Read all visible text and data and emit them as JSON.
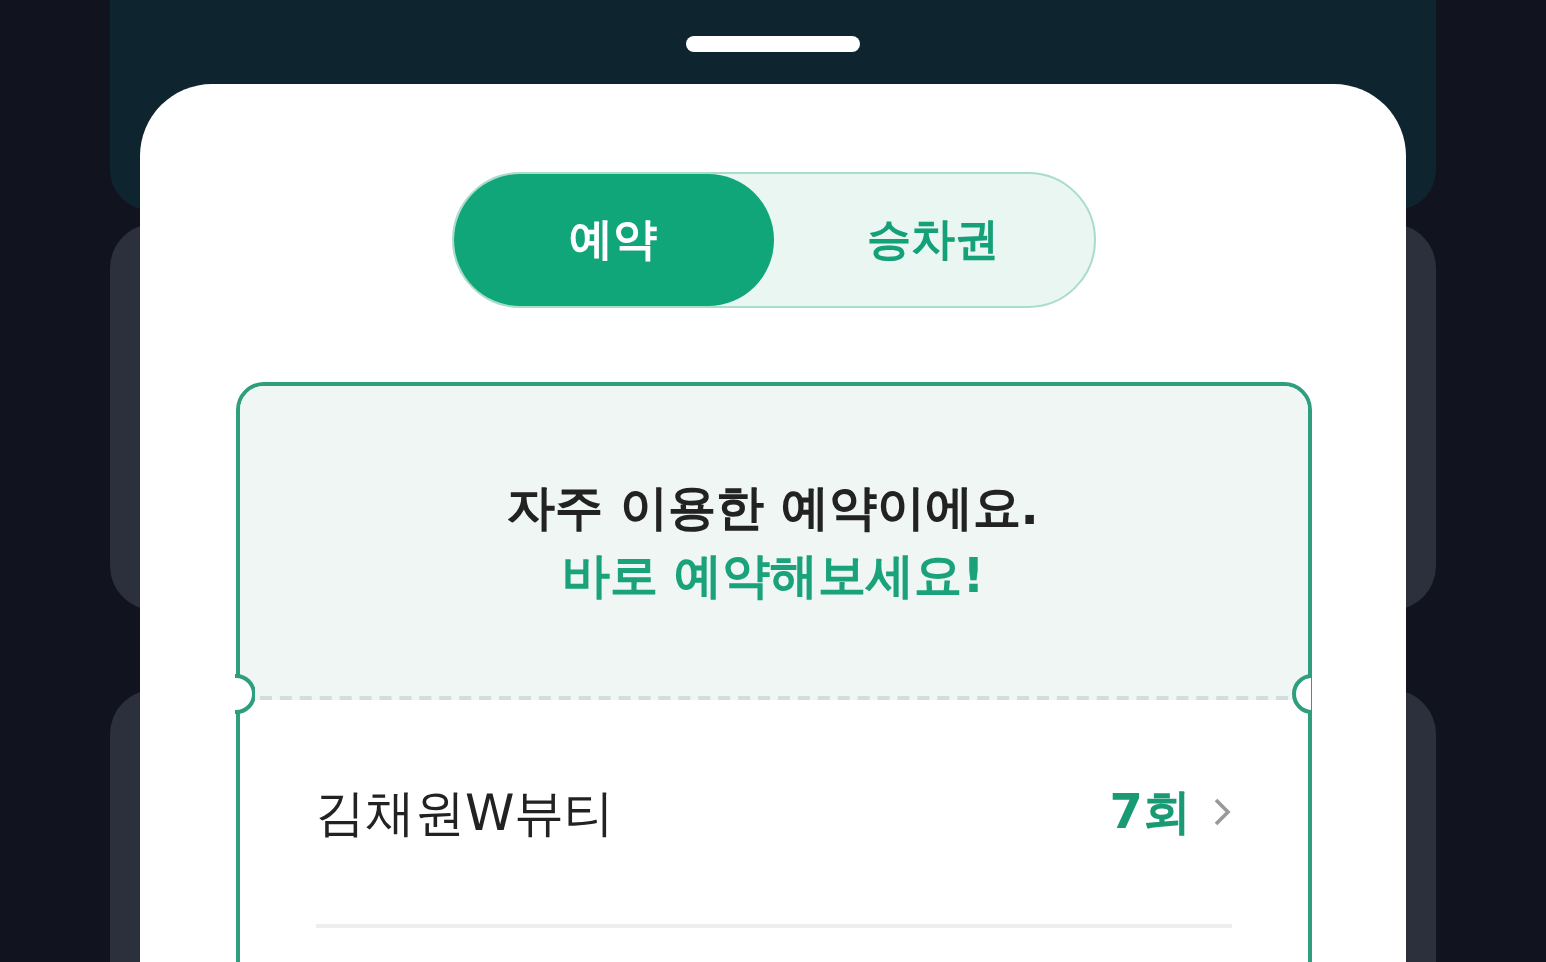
{
  "tabs": [
    {
      "label": "예약",
      "selected": true
    },
    {
      "label": "승차권",
      "selected": false
    }
  ],
  "ticket": {
    "title": "자주 이용한 예약이에요.",
    "subtitle": "바로 예약해보세요!",
    "rows": [
      {
        "name": "김채원W뷰티",
        "count": "7회"
      }
    ]
  }
}
